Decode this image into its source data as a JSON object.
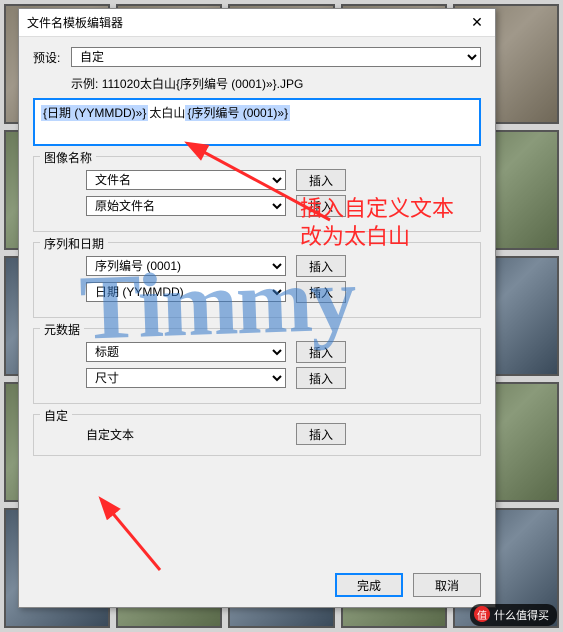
{
  "dialog": {
    "title": "文件名模板编辑器",
    "preset_label": "预设:",
    "preset_value": "自定",
    "example_label": "示例:",
    "example_value": "111020太白山{序列编号 (0001)»}.JPG",
    "template_tokens": {
      "t0": "{日期 (YYMMDD)»}",
      "t1": "太白山",
      "t2": "{序列编号 (0001)»}"
    },
    "groups": {
      "image_name": {
        "label": "图像名称",
        "opt1": "文件名",
        "opt2": "原始文件名",
        "insert": "插入"
      },
      "seq_date": {
        "label": "序列和日期",
        "opt1": "序列编号 (0001)",
        "opt2": "日期 (YYMMDD)",
        "insert": "插入"
      },
      "metadata": {
        "label": "元数据",
        "opt1": "标题",
        "opt2": "尺寸",
        "insert": "插入"
      },
      "custom": {
        "label": "自定",
        "text_label": "自定文本",
        "insert": "插入"
      }
    },
    "done": "完成",
    "cancel": "取消"
  },
  "annotation": {
    "line1": "插入自定义文本",
    "line2": "改为太白山"
  },
  "watermark": "Timmy",
  "badge": "什么值得买"
}
